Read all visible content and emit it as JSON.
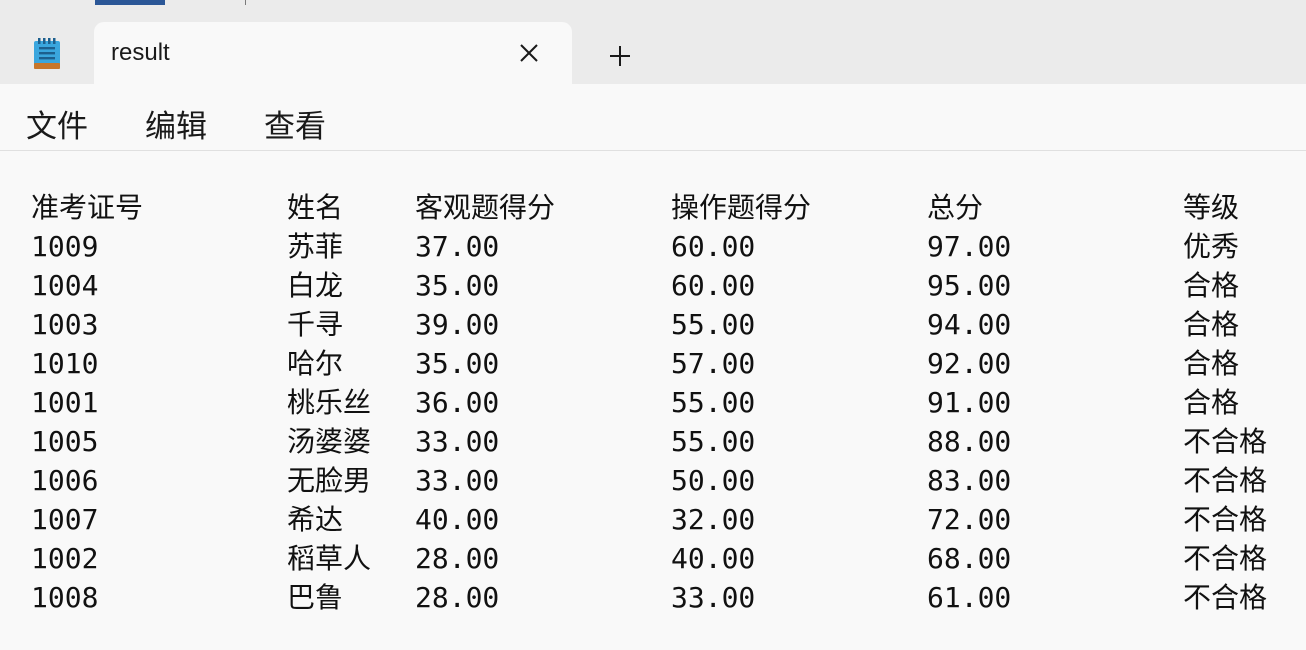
{
  "window": {
    "tab_title": "result",
    "new_tab_icon": "plus-icon",
    "close_icon": "close-icon",
    "app_icon": "notepad-icon"
  },
  "menu": [
    "文件",
    "编辑",
    "查看"
  ],
  "table": {
    "headers": [
      "准考证号",
      "姓名",
      "客观题得分",
      "操作题得分",
      "总分",
      "等级"
    ],
    "rows": [
      [
        "1009",
        "苏菲",
        "37.00",
        "60.00",
        "97.00",
        "优秀"
      ],
      [
        "1004",
        "白龙",
        "35.00",
        "60.00",
        "95.00",
        "合格"
      ],
      [
        "1003",
        "千寻",
        "39.00",
        "55.00",
        "94.00",
        "合格"
      ],
      [
        "1010",
        "哈尔",
        "35.00",
        "57.00",
        "92.00",
        "合格"
      ],
      [
        "1001",
        "桃乐丝",
        "36.00",
        "55.00",
        "91.00",
        "合格"
      ],
      [
        "1005",
        "汤婆婆",
        "33.00",
        "55.00",
        "88.00",
        "不合格"
      ],
      [
        "1006",
        "无脸男",
        "33.00",
        "50.00",
        "83.00",
        "不合格"
      ],
      [
        "1007",
        "希达",
        "40.00",
        "32.00",
        "72.00",
        "不合格"
      ],
      [
        "1002",
        "稻草人",
        "28.00",
        "40.00",
        "68.00",
        "不合格"
      ],
      [
        "1008",
        "巴鲁",
        "28.00",
        "33.00",
        "61.00",
        "不合格"
      ]
    ]
  }
}
